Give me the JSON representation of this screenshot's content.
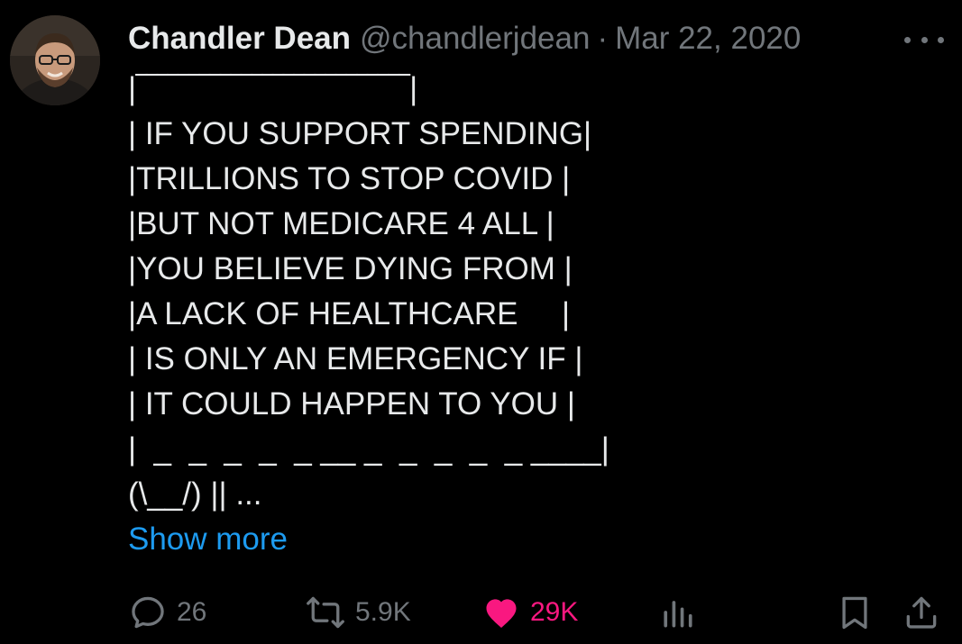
{
  "tweet": {
    "author_name": "Chandler Dean",
    "handle": "@chandlerjdean",
    "separator": "·",
    "date": "Mar 22, 2020",
    "lines": [
      "|‾‾‾‾‾‾‾‾‾‾‾‾‾‾‾‾‾‾‾‾‾‾‾‾‾‾|",
      "| IF YOU SUPPORT SPENDING|",
      "|TRILLIONS TO STOP COVID |",
      "|BUT NOT MEDICARE 4 ALL |",
      "|YOU BELIEVE DYING FROM |",
      "|A LACK OF HEALTHCARE     |",
      "| IS ONLY AN EMERGENCY IF |",
      "| IT COULD HAPPEN TO YOU |",
      "|  _  _  _  _  _ __ _  _  _  _  _ ____|",
      "(\\__/) || ..."
    ],
    "show_more": "Show more"
  },
  "actions": {
    "replies": "26",
    "reposts": "5.9K",
    "likes": "29K"
  },
  "colors": {
    "background": "#000000",
    "text": "#e7e9ea",
    "muted": "#71767b",
    "link": "#1d9bf0",
    "like": "#f91880"
  },
  "icons": [
    "more-icon",
    "reply-icon",
    "repost-icon",
    "like-icon",
    "views-icon",
    "bookmark-icon",
    "share-icon"
  ]
}
